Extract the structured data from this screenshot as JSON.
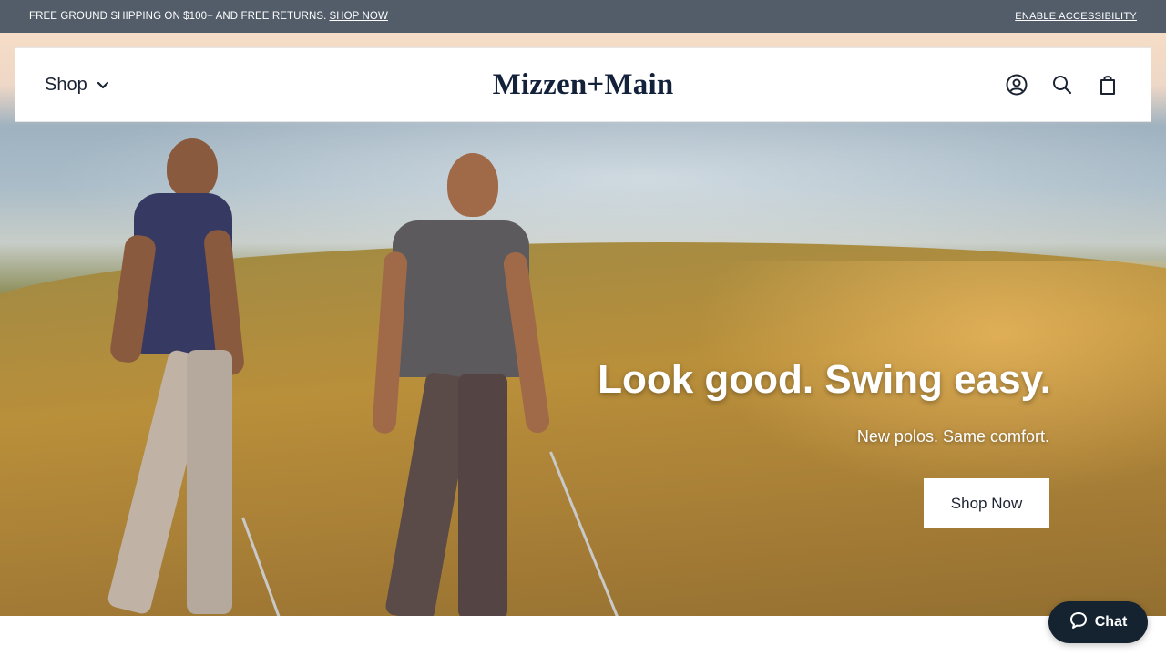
{
  "announcement": {
    "text": "FREE GROUND SHIPPING ON $100+ AND FREE RETURNS.",
    "link": "SHOP NOW",
    "accessibility": "ENABLE ACCESSIBILITY"
  },
  "header": {
    "shop_label": "Shop",
    "logo": "Mizzen+Main",
    "icons": [
      "account-icon",
      "search-icon",
      "cart-icon"
    ]
  },
  "hero": {
    "title": "Look good. Swing easy.",
    "subtitle": "New polos. Same comfort.",
    "cta": "Shop Now"
  },
  "chat": {
    "label": "Chat"
  },
  "colors": {
    "announcement_bg": "#525d69",
    "brand_navy": "#14213a",
    "chat_bg": "#152331"
  }
}
